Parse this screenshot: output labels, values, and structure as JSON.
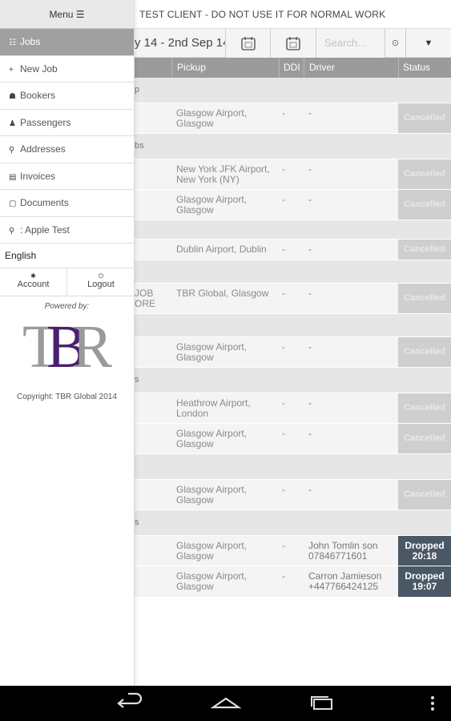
{
  "client_banner": "TEST CLIENT - DO NOT USE IT FOR NORMAL WORK",
  "filter": {
    "date_range": "y 14 - 2nd Sep 14",
    "search_placeholder": "Search...",
    "search_go": "⊙",
    "sort": "▼"
  },
  "table": {
    "headers": [
      "Pickup",
      "DDI",
      "Driver",
      "Status"
    ],
    "rows": [
      {
        "kind": "group",
        "label": "p"
      },
      {
        "kind": "job",
        "ref": "",
        "pickup1": "Glasgow Airport,",
        "pickup2": "Glasgow",
        "ddi": "-",
        "driver1": "-",
        "driver2": "",
        "status1": "Cancelled",
        "status2": ""
      },
      {
        "kind": "group",
        "label": "bs"
      },
      {
        "kind": "job",
        "ref": "",
        "pickup1": "New York JFK Airport,",
        "pickup2": "New York (NY)",
        "ddi": "-",
        "driver1": "-",
        "driver2": "",
        "status1": "Cancelled",
        "status2": ""
      },
      {
        "kind": "job",
        "ref": "",
        "pickup1": "Glasgow Airport,",
        "pickup2": "Glasgow",
        "ddi": "-",
        "driver1": "-",
        "driver2": "",
        "status1": "Cancelled",
        "status2": ""
      },
      {
        "kind": "group",
        "label": ""
      },
      {
        "kind": "job",
        "ref": "",
        "pickup1": "Dublin Airport, Dublin",
        "pickup2": "",
        "ddi": "-",
        "driver1": "-",
        "driver2": "",
        "status1": "Cancelled",
        "status2": ""
      },
      {
        "kind": "group",
        "label": ""
      },
      {
        "kind": "job",
        "ref": "JOB\nORE",
        "pickup1": "TBR Global, Glasgow",
        "pickup2": "",
        "ddi": "-",
        "driver1": "-",
        "driver2": "",
        "status1": "Cancelled",
        "status2": ""
      },
      {
        "kind": "group",
        "label": ""
      },
      {
        "kind": "job",
        "ref": "",
        "pickup1": "Glasgow Airport,",
        "pickup2": "Glasgow",
        "ddi": "-",
        "driver1": "-",
        "driver2": "",
        "status1": "Cancelled",
        "status2": ""
      },
      {
        "kind": "group",
        "label": "s"
      },
      {
        "kind": "job",
        "ref": "",
        "pickup1": "Heathrow Airport,",
        "pickup2": "London",
        "ddi": "-",
        "driver1": "-",
        "driver2": "",
        "status1": "Cancelled",
        "status2": ""
      },
      {
        "kind": "job",
        "ref": "",
        "pickup1": "Glasgow Airport,",
        "pickup2": "Glasgow",
        "ddi": "-",
        "driver1": "-",
        "driver2": "",
        "status1": "Cancelled",
        "status2": ""
      },
      {
        "kind": "group",
        "label": ""
      },
      {
        "kind": "job",
        "ref": "",
        "pickup1": "Glasgow Airport,",
        "pickup2": "Glasgow",
        "ddi": "-",
        "driver1": "-",
        "driver2": "",
        "status1": "Cancelled",
        "status2": ""
      },
      {
        "kind": "group",
        "label": "s"
      },
      {
        "kind": "job",
        "ref": "",
        "pickup1": "Glasgow Airport,",
        "pickup2": "Glasgow",
        "ddi": "-",
        "driver1": "John Tomlin son",
        "driver2": "07846771601",
        "status1": "Dropped",
        "status2": "20:18"
      },
      {
        "kind": "job",
        "ref": "",
        "pickup1": "Glasgow Airport,",
        "pickup2": "Glasgow",
        "ddi": "-",
        "driver1": "Carron Jamieson",
        "driver2": "+447766424125",
        "status1": "Dropped",
        "status2": "19:07"
      }
    ]
  },
  "drawer": {
    "menu_label": "Menu ☰",
    "items": [
      {
        "icon": "☷",
        "label": "Jobs",
        "active": true
      },
      {
        "icon": "+",
        "label": "New Job",
        "active": false
      },
      {
        "icon": "☗",
        "label": "Bookers",
        "active": false
      },
      {
        "icon": "♟",
        "label": "Passengers",
        "active": false
      },
      {
        "icon": "⚲",
        "label": "Addresses",
        "active": false
      },
      {
        "icon": "▤",
        "label": "Invoices",
        "active": false
      },
      {
        "icon": "▢",
        "label": "Documents",
        "active": false
      },
      {
        "icon": "⚲",
        "label": ": Apple Test",
        "active": false
      }
    ],
    "language": "English",
    "account_label": "Account",
    "logout_label": "Logout",
    "powered_by": "Powered by:",
    "logo_text": "TBR",
    "copyright": "Copyright: TBR Global 2014"
  },
  "colors": {
    "logo_purple": "#4a1f6e",
    "logo_grey": "#9a9a9a",
    "status_cancelled": "#cfcfcf",
    "status_dropped": "#4a5866",
    "header_grey": "#9b9b9b"
  },
  "icons": {
    "calendar_from": "calendar-icon",
    "calendar_to": "calendar-icon",
    "back": "back-icon",
    "home": "home-icon",
    "recents": "recents-icon",
    "overflow": "overflow-menu-icon"
  }
}
